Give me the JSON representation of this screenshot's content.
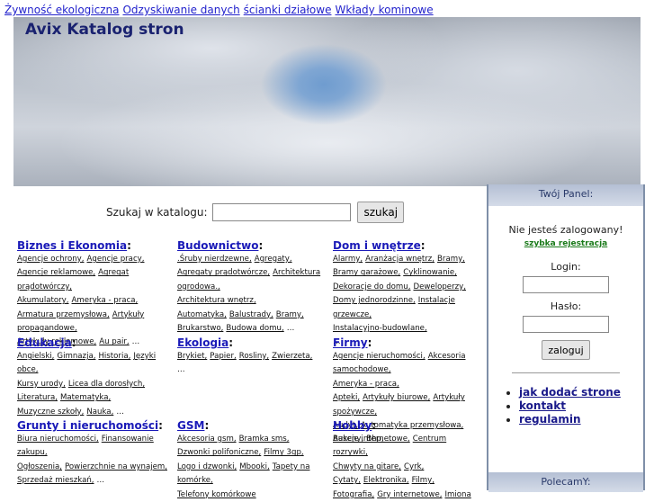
{
  "toplinks": [
    "Żywność ekologiczna",
    "Odzyskiwanie danych",
    "ścianki działowe",
    "Wkłady kominowe"
  ],
  "banner": {
    "title": "Avix Katalog stron"
  },
  "search": {
    "label": "Szukaj w katalogu:",
    "value": "",
    "button": "szukaj"
  },
  "categories": [
    {
      "title": "Biznes i Ekonomia",
      "subs": [
        "Agencje ochrony",
        "Agencje pracy",
        "Agencje reklamowe",
        "Agregat prądotwórczy",
        "Akumulatory",
        "Ameryka - praca",
        "Armatura przemysłowa",
        "Artykuły propagandowe",
        "Artykuły reklamowe",
        "Au pair"
      ]
    },
    {
      "title": "Budownictwo",
      "subs": [
        ".Śruby nierdzewne",
        "Agregaty",
        "Agregaty prądotwórcze",
        "Architektura ogrodowa.",
        "Architektura wnętrz",
        "Automatyka",
        "Balustrady",
        "Bramy",
        "Brukarstwo",
        "Budowa domu"
      ]
    },
    {
      "title": "Dom i wnętrze",
      "subs": [
        "Alarmy",
        "Aranżacja wnętrz",
        "Bramy",
        "Bramy garażowe",
        "Cyklinowanie",
        "Dekoracje do domu",
        "Deweloperzy",
        "Domy jednorodzinne",
        "Instalacje grzewcze",
        "Instalacyjno-budowlane"
      ]
    },
    {
      "title": "Edukacja",
      "subs": [
        "Angielski",
        "Gimnazja",
        "Historia",
        "Języki obce",
        "Kursy urody",
        "Licea dla dorosłych",
        "Literatura",
        "Matematyka",
        "Muzyczne szkoły",
        "Nauka"
      ]
    },
    {
      "title": "Ekologia",
      "subs": [
        "Brykiet",
        "Papier",
        "Rosliny",
        "Zwierzeta"
      ]
    },
    {
      "title": "Firmy",
      "subs": [
        "Agencje nieruchomości",
        "Akcesoria samochodowe",
        "Ameryka - praca",
        "Apteki",
        "Artykuły biurowe",
        "Artykuły spożywcze",
        "Audyt",
        "Automatyka przemysłowa",
        "Baseny",
        "Bhp"
      ]
    },
    {
      "title": "Grunty i nieruchomości",
      "subs": [
        "Biura nieruchomości",
        "Finansowanie zakupu",
        "Ogłoszenia",
        "Powierzchnie na wynajem",
        "Sprzedaż mieszkań"
      ]
    },
    {
      "title": "GSM",
      "subs": [
        "Akcesoria gsm",
        "Bramka sms",
        "Dzwonki polifoniczne",
        "Filmy 3gp",
        "Logo i dzwonki",
        "Mbooki",
        "Tapety na komórke",
        "Telefony komórkowe"
      ]
    },
    {
      "title": "Hobby",
      "subs": [
        "Aukcje internetowe",
        "Centrum rozrywki",
        "Chwyty na gitare",
        "Cyrk",
        "Cytaty",
        "Elektronika",
        "Filmy",
        "Fotografia",
        "Gry internetowe",
        "Imiona"
      ]
    }
  ],
  "more": "…",
  "panel": {
    "title": "Twój Panel:",
    "status": "Nie jesteś zalogowany!",
    "register": "szybka rejestracja",
    "login_label": "Login:",
    "password_label": "Hasło:",
    "login_button": "zaloguj",
    "links": [
      "jak dodać strone",
      "kontakt",
      "regulamin"
    ],
    "footer": "PolecamY:"
  }
}
